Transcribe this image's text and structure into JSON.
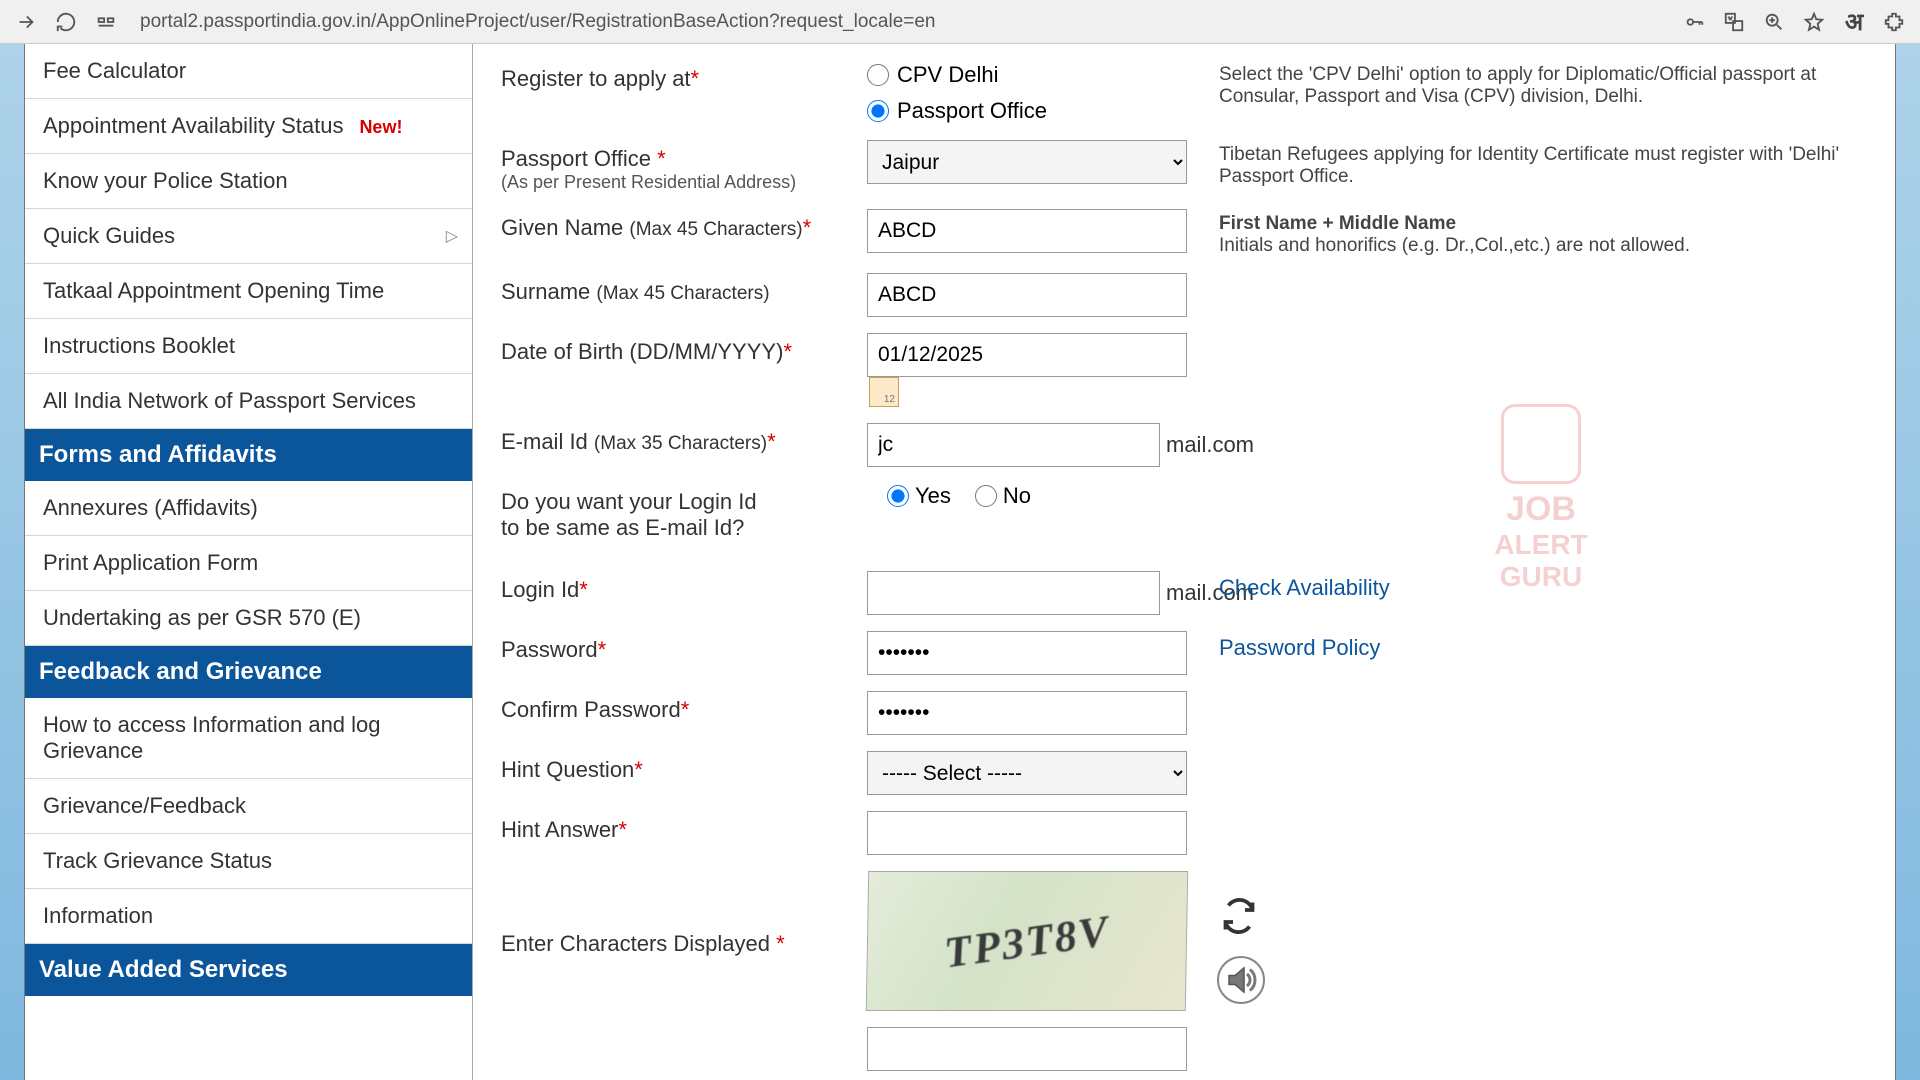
{
  "url": "portal2.passportindia.gov.in/AppOnlineProject/user/RegistrationBaseAction?request_locale=en",
  "sidebar": {
    "items": [
      {
        "label": "Fee Calculator"
      },
      {
        "label": "Appointment Availability Status",
        "badge": "New!"
      },
      {
        "label": "Know your Police Station"
      },
      {
        "label": "Quick Guides",
        "expandable": true
      },
      {
        "label": "Tatkaal Appointment Opening Time"
      },
      {
        "label": "Instructions Booklet"
      },
      {
        "label": "All India Network of Passport Services"
      }
    ],
    "headers": [
      {
        "label": "Forms and Affidavits"
      }
    ],
    "forms_items": [
      {
        "label": "Annexures (Affidavits)"
      },
      {
        "label": "Print Application Form"
      },
      {
        "label": "Undertaking as per GSR 570 (E)"
      }
    ],
    "feedback_header": "Feedback and Grievance",
    "feedback_items": [
      {
        "label": "How to access Information and log Grievance"
      },
      {
        "label": "Grievance/Feedback"
      },
      {
        "label": "Track Grievance Status"
      },
      {
        "label": "Information"
      }
    ],
    "vas_header": "Value Added Services"
  },
  "form": {
    "register_label": "Register to apply at",
    "register_opt1": "CPV Delhi",
    "register_opt2": "Passport Office",
    "register_help": "Select the 'CPV Delhi' option to apply for Diplomatic/Official passport at Consular, Passport and Visa (CPV) division, Delhi.",
    "po_label": "Passport Office ",
    "po_sub": "(As per Present Residential Address)",
    "po_value": "Jaipur",
    "po_help": "Tibetan Refugees applying for Identity Certificate must register with 'Delhi' Passport Office.",
    "given_label": "Given Name ",
    "given_chars": "(Max 45 Characters)",
    "given_value": "ABCD",
    "given_help_bold": "First Name + Middle Name",
    "given_help": "Initials and honorifics (e.g. Dr.,Col.,etc.) are not allowed.",
    "surname_label": "Surname ",
    "surname_chars": "(Max 45 Characters)",
    "surname_value": "ABCD",
    "dob_label": "Date of Birth (DD/MM/YYYY)",
    "dob_value": "01/12/2025",
    "email_label": "E-mail Id ",
    "email_chars": "(Max 35 Characters)",
    "email_prefix": "jc",
    "email_suffix": "mail.com",
    "sameid_label": "Do you want your Login Id\n  to be same as E-mail Id?",
    "sameid_yes": "Yes",
    "sameid_no": "No",
    "login_label": "Login Id",
    "login_suffix": "mail.com",
    "check_avail": "Check Availability",
    "pw_label": "Password",
    "pw_value": "•••••••",
    "pw_policy": "Password Policy",
    "cpw_label": "Confirm Password",
    "cpw_value": "•••••••",
    "hint_q_label": "Hint Question",
    "hint_q_value": "----- Select -----",
    "hint_a_label": "Hint Answer",
    "captcha_label": "Enter Characters Displayed ",
    "captcha_text": "TP3T8V"
  },
  "browser_lang": "अ"
}
